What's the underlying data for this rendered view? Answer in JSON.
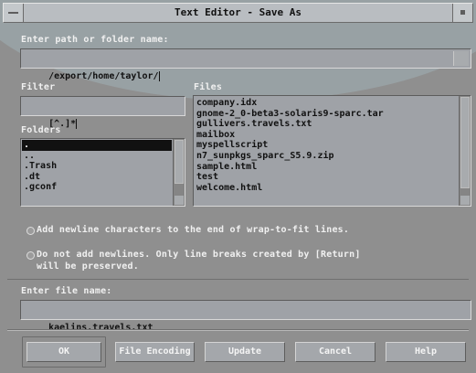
{
  "window": {
    "title": "Text Editor - Save As"
  },
  "path": {
    "label": "Enter path or folder name:",
    "value": "/export/home/taylor/"
  },
  "filter": {
    "label": "Filter",
    "value": "[^.]*"
  },
  "folders": {
    "label": "Folders",
    "items": [
      ".",
      "..",
      ".Trash",
      ".dt",
      ".gconf"
    ],
    "selected_index": 0
  },
  "files": {
    "label": "Files",
    "items": [
      "company.idx",
      "gnome-2_0-beta3-solaris9-sparc.tar",
      "gullivers.travels.txt",
      "mailbox",
      "myspellscript",
      "n7_sunpkgs_sparc_S5.9.zip",
      "sample.html",
      "test",
      "welcome.html"
    ]
  },
  "options": {
    "add_newline": "Add newline characters to the end of wrap-to-fit lines.",
    "no_newline_line1": "Do not add newlines.  Only line breaks created by [Return]",
    "no_newline_line2": "will be preserved."
  },
  "filename": {
    "label": "Enter file name:",
    "value": "kaelins.travels.txt"
  },
  "buttons": {
    "ok": "OK",
    "file_encoding": "File Encoding",
    "update": "Update",
    "cancel": "Cancel",
    "help": "Help"
  }
}
